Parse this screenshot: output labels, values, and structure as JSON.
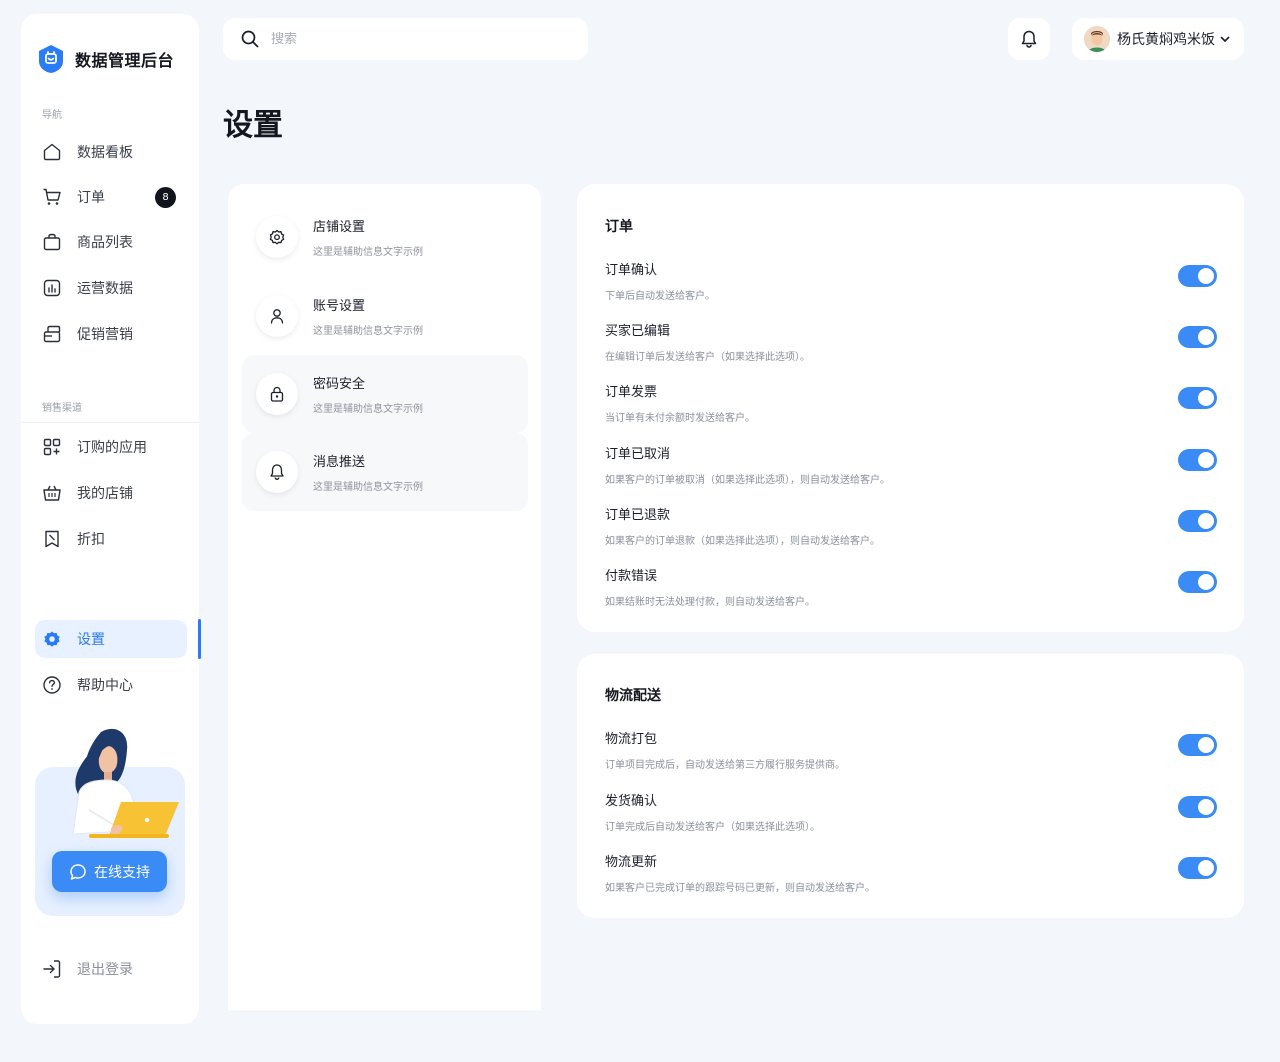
{
  "brand": {
    "name": "数据管理后台",
    "accent": "#2a7bf6"
  },
  "sidebar": {
    "section_nav": "导航",
    "section_channels": "销售渠道",
    "items": [
      {
        "label": "数据看板",
        "icon": "home-icon"
      },
      {
        "label": "订单",
        "icon": "cart-icon",
        "badge": "8"
      },
      {
        "label": "商品列表",
        "icon": "bag-icon"
      },
      {
        "label": "运营数据",
        "icon": "chart-icon"
      },
      {
        "label": "促销营销",
        "icon": "promotion-icon"
      }
    ],
    "channel_items": [
      {
        "label": "订购的应用",
        "icon": "apps-icon"
      },
      {
        "label": "我的店铺",
        "icon": "basket-icon"
      },
      {
        "label": "折扣",
        "icon": "discount-icon"
      }
    ],
    "bottom_items": [
      {
        "label": "设置",
        "icon": "gear-icon",
        "active": true
      },
      {
        "label": "帮助中心",
        "icon": "help-icon"
      }
    ],
    "support_label": "在线支持",
    "logout_label": "退出登录"
  },
  "header": {
    "search_placeholder": "搜索",
    "user_name": "杨氏黄焖鸡米饭"
  },
  "page_title": "设置",
  "settings_menu": [
    {
      "title": "店铺设置",
      "subtitle": "这里是辅助信息文字示例",
      "icon": "gear-icon"
    },
    {
      "title": "账号设置",
      "subtitle": "这里是辅助信息文字示例",
      "icon": "user-icon"
    },
    {
      "title": "密码安全",
      "subtitle": "这里是辅助信息文字示例",
      "icon": "lock-icon",
      "selected": true
    },
    {
      "title": "消息推送",
      "subtitle": "这里是辅助信息文字示例",
      "icon": "bell-icon"
    }
  ],
  "orders_panel": {
    "title": "订单",
    "rows": [
      {
        "title": "订单确认",
        "desc": "下单后自动发送给客户。",
        "enabled": true
      },
      {
        "title": "买家已编辑",
        "desc": "在编辑订单后发送给客户（如果选择此选项）。",
        "enabled": true
      },
      {
        "title": "订单发票",
        "desc": "当订单有未付余额时发送给客户。",
        "enabled": true
      },
      {
        "title": "订单已取消",
        "desc": "如果客户的订单被取消（如果选择此选项），则自动发送给客户。",
        "enabled": true
      },
      {
        "title": "订单已退款",
        "desc": "如果客户的订单退款（如果选择此选项），则自动发送给客户。",
        "enabled": true
      },
      {
        "title": "付款错误",
        "desc": "如果结账时无法处理付款，则自动发送给客户。",
        "enabled": true
      }
    ]
  },
  "shipping_panel": {
    "title": "物流配送",
    "rows": [
      {
        "title": "物流打包",
        "desc": "订单项目完成后，自动发送给第三方履行服务提供商。",
        "enabled": true
      },
      {
        "title": "发货确认",
        "desc": "订单完成后自动发送给客户（如果选择此选项）。",
        "enabled": true
      },
      {
        "title": "物流更新",
        "desc": "如果客户已完成订单的跟踪号码已更新，则自动发送给客户。",
        "enabled": true
      }
    ]
  }
}
